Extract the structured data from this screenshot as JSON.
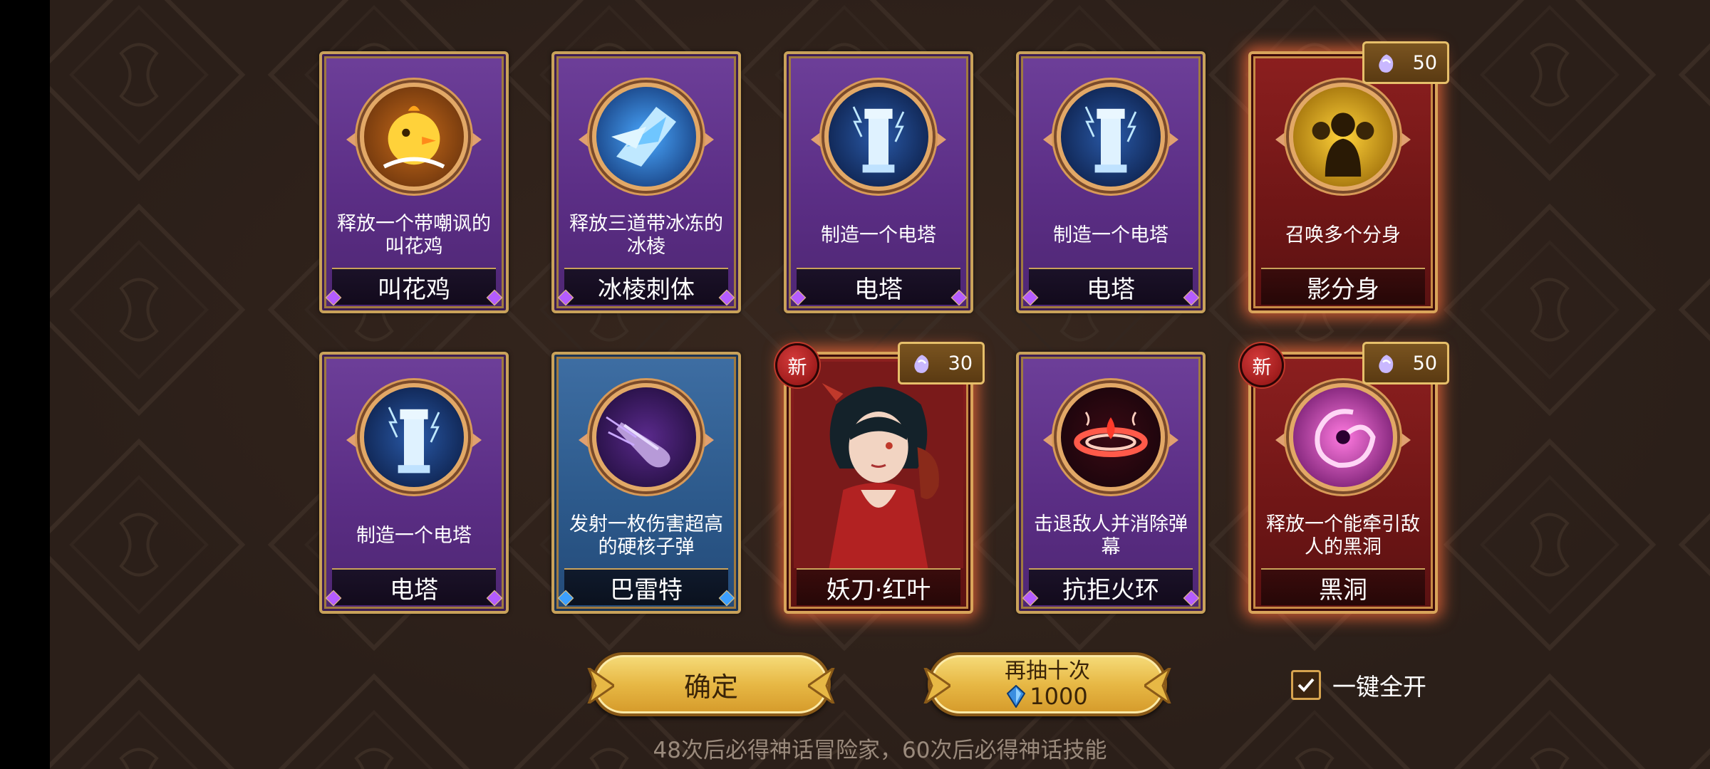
{
  "cards": [
    {
      "desc": "释放一个带嘲讽的叫花鸡",
      "name": "叫花鸡",
      "icon": "chicken-icon",
      "rarity": "purple"
    },
    {
      "desc": "释放三道带冰冻的冰棱",
      "name": "冰棱刺体",
      "icon": "ice-shard-icon",
      "rarity": "purple"
    },
    {
      "desc": "制造一个电塔",
      "name": "电塔",
      "icon": "electric-tower-icon",
      "rarity": "purple"
    },
    {
      "desc": "制造一个电塔",
      "name": "电塔",
      "icon": "electric-tower-icon",
      "rarity": "purple"
    },
    {
      "desc": "召唤多个分身",
      "name": "影分身",
      "icon": "shadow-clone-icon",
      "rarity": "red",
      "cost": "50"
    },
    {
      "desc": "制造一个电塔",
      "name": "电塔",
      "icon": "electric-tower-icon",
      "rarity": "purple"
    },
    {
      "desc": "发射一枚伤害超高的硬核子弹",
      "name": "巴雷特",
      "icon": "bullet-icon",
      "rarity": "blue"
    },
    {
      "desc": "",
      "name": "妖刀·红叶",
      "icon": "hero-portrait",
      "rarity": "red",
      "cost": "30",
      "new_label": "新"
    },
    {
      "desc": "击退敌人并消除弹幕",
      "name": "抗拒火环",
      "icon": "fire-ring-icon",
      "rarity": "purple"
    },
    {
      "desc": "释放一个能牵引敌人的黑洞",
      "name": "黑洞",
      "icon": "black-hole-icon",
      "rarity": "red",
      "cost": "50",
      "new_label": "新"
    }
  ],
  "buttons": {
    "confirm": "确定",
    "redraw_line1": "再抽十次",
    "redraw_cost": "1000"
  },
  "toggle": {
    "label": "一键全开",
    "checked": true
  },
  "footer_note": "48次后必得神话冒险家，60次后必得神话技能",
  "colors": {
    "purple": "#5b2e85",
    "blue": "#2d5a8c",
    "red": "#6f1616",
    "gold": "#e7b845"
  }
}
